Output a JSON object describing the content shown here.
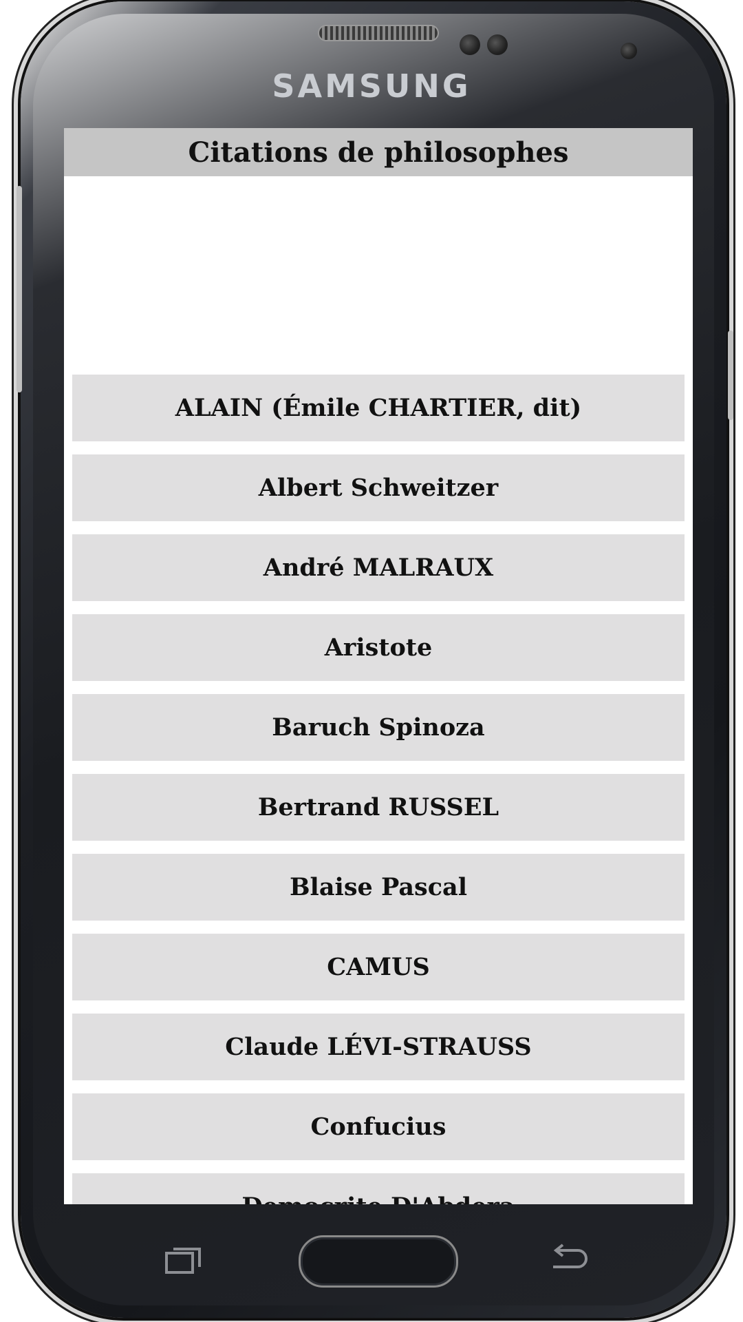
{
  "device": {
    "brand": "SAMSUNG"
  },
  "app": {
    "title": "Citations de philosophes"
  },
  "philosophers": [
    "ALAIN (Émile CHARTIER, dit)",
    "Albert Schweitzer",
    "André MALRAUX",
    "Aristote",
    "Baruch Spinoza",
    "Bertrand RUSSEL",
    "Blaise Pascal",
    "CAMUS",
    "Claude LÉVI-STRAUSS",
    "Confucius",
    "Democrite D'Abdera"
  ],
  "colors": {
    "title_bar": "#c5c5c5",
    "list_item": "#e0dfe0",
    "text": "#111111"
  },
  "icons": {
    "recent_apps": "recent-apps-icon",
    "home": "home-button",
    "back": "back-icon"
  }
}
